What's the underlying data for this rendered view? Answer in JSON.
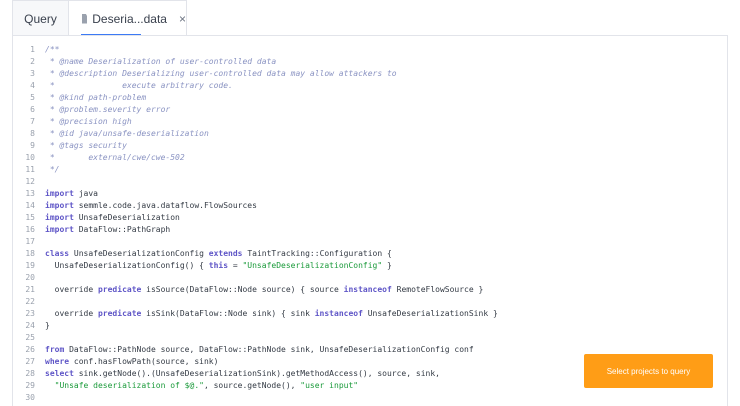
{
  "tabs": [
    {
      "label": "Query",
      "active": false
    },
    {
      "label": "Deseria...data",
      "active": true,
      "icon": "file-icon",
      "close": "×"
    }
  ],
  "editor": {
    "lines": [
      {
        "n": "1",
        "comment": true,
        "parts": [
          {
            "t": "/**"
          }
        ]
      },
      {
        "n": "2",
        "comment": true,
        "parts": [
          {
            "t": " * @name Deserialization of user-controlled data"
          }
        ]
      },
      {
        "n": "3",
        "comment": true,
        "parts": [
          {
            "t": " * @description Deserializing user-controlled data may allow attackers to"
          }
        ]
      },
      {
        "n": "4",
        "comment": true,
        "parts": [
          {
            "t": " *              execute arbitrary code."
          }
        ]
      },
      {
        "n": "5",
        "comment": true,
        "parts": [
          {
            "t": " * @kind path-problem"
          }
        ]
      },
      {
        "n": "6",
        "comment": true,
        "parts": [
          {
            "t": " * @problem.severity error"
          }
        ]
      },
      {
        "n": "7",
        "comment": true,
        "parts": [
          {
            "t": " * @precision high"
          }
        ]
      },
      {
        "n": "8",
        "comment": true,
        "parts": [
          {
            "t": " * @id java/unsafe-deserialization"
          }
        ]
      },
      {
        "n": "9",
        "comment": true,
        "parts": [
          {
            "t": " * @tags security"
          }
        ]
      },
      {
        "n": "10",
        "comment": true,
        "parts": [
          {
            "t": " *       external/cwe/cwe-502"
          }
        ]
      },
      {
        "n": "11",
        "comment": true,
        "parts": [
          {
            "t": " */"
          }
        ]
      },
      {
        "n": "12",
        "parts": []
      },
      {
        "n": "13",
        "parts": [
          {
            "t": "import",
            "c": "kw"
          },
          {
            "t": " java"
          }
        ]
      },
      {
        "n": "14",
        "parts": [
          {
            "t": "import",
            "c": "kw"
          },
          {
            "t": " semmle.code.java.dataflow.FlowSources"
          }
        ]
      },
      {
        "n": "15",
        "parts": [
          {
            "t": "import",
            "c": "kw"
          },
          {
            "t": " UnsafeDeserialization"
          }
        ]
      },
      {
        "n": "16",
        "parts": [
          {
            "t": "import",
            "c": "kw"
          },
          {
            "t": " DataFlow::PathGraph"
          }
        ]
      },
      {
        "n": "17",
        "parts": []
      },
      {
        "n": "18",
        "parts": [
          {
            "t": "class",
            "c": "kw"
          },
          {
            "t": " UnsafeDeserializationConfig "
          },
          {
            "t": "extends",
            "c": "kw"
          },
          {
            "t": " TaintTracking::Configuration {"
          }
        ]
      },
      {
        "n": "19",
        "parts": [
          {
            "t": "  UnsafeDeserializationConfig() { "
          },
          {
            "t": "this",
            "c": "kw"
          },
          {
            "t": " = "
          },
          {
            "t": "\"UnsafeDeserializationConfig\"",
            "c": "str"
          },
          {
            "t": " }"
          }
        ]
      },
      {
        "n": "20",
        "parts": []
      },
      {
        "n": "21",
        "parts": [
          {
            "t": "  override "
          },
          {
            "t": "predicate",
            "c": "kw"
          },
          {
            "t": " isSource(DataFlow::Node source) { source "
          },
          {
            "t": "instanceof",
            "c": "kw"
          },
          {
            "t": " RemoteFlowSource }"
          }
        ]
      },
      {
        "n": "22",
        "parts": []
      },
      {
        "n": "23",
        "parts": [
          {
            "t": "  override "
          },
          {
            "t": "predicate",
            "c": "kw"
          },
          {
            "t": " isSink(DataFlow::Node sink) { sink "
          },
          {
            "t": "instanceof",
            "c": "kw"
          },
          {
            "t": " UnsafeDeserializationSink }"
          }
        ]
      },
      {
        "n": "24",
        "parts": [
          {
            "t": "}"
          }
        ]
      },
      {
        "n": "25",
        "parts": []
      },
      {
        "n": "26",
        "parts": [
          {
            "t": "from",
            "c": "kw"
          },
          {
            "t": " DataFlow::PathNode source, DataFlow::PathNode sink, UnsafeDeserializationConfig conf"
          }
        ]
      },
      {
        "n": "27",
        "parts": [
          {
            "t": "where",
            "c": "kw"
          },
          {
            "t": " conf.hasFlowPath(source, sink)"
          }
        ]
      },
      {
        "n": "28",
        "parts": [
          {
            "t": "select",
            "c": "kw"
          },
          {
            "t": " sink.getNode().(UnsafeDeserializationSink).getMethodAccess(), source, sink,"
          }
        ]
      },
      {
        "n": "29",
        "parts": [
          {
            "t": "  "
          },
          {
            "t": "\"Unsafe deserialization of $@.\"",
            "c": "str"
          },
          {
            "t": ", source.getNode(), "
          },
          {
            "t": "\"user input\"",
            "c": "str"
          }
        ]
      },
      {
        "n": "30",
        "parts": []
      }
    ]
  },
  "cta": {
    "label": "Select projects to query",
    "color": "#ff9d16"
  }
}
